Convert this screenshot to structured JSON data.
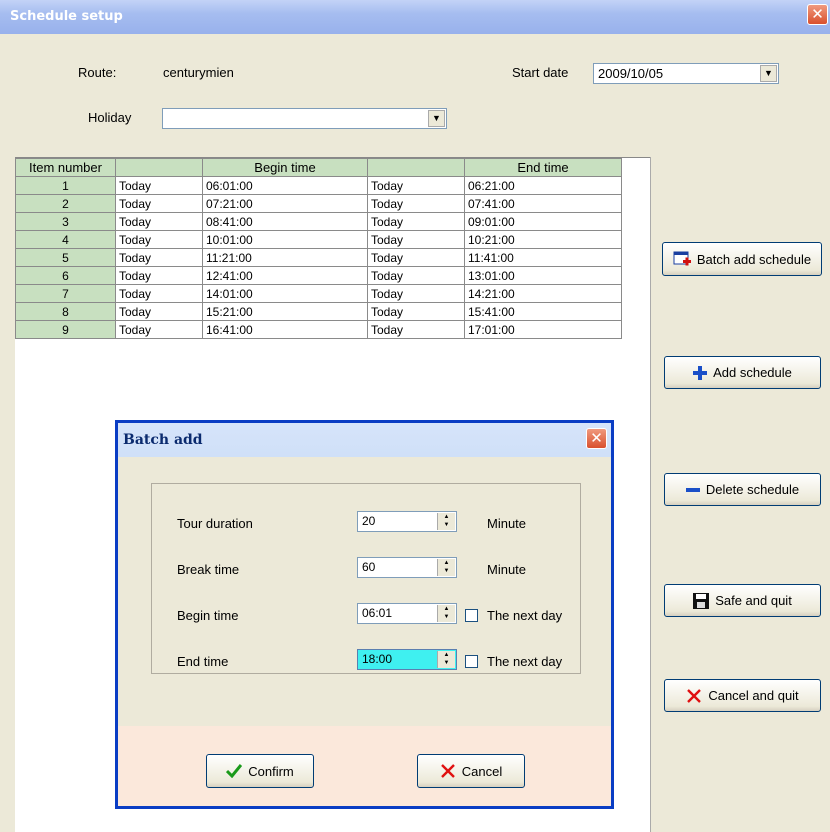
{
  "window": {
    "title": "Schedule setup",
    "close": "✕"
  },
  "form": {
    "route_label": "Route:",
    "route_value": "centurymien",
    "start_date_label": "Start date",
    "start_date_value": "2009/10/05",
    "holiday_label": "Holiday",
    "holiday_value": "",
    "dropdown_arrow": "▼"
  },
  "table": {
    "headers": [
      "Item number",
      "",
      "Begin time",
      "",
      "End time"
    ],
    "rows": [
      [
        "1",
        "Today",
        "06:01:00",
        "Today",
        "06:21:00"
      ],
      [
        "2",
        "Today",
        "07:21:00",
        "Today",
        "07:41:00"
      ],
      [
        "3",
        "Today",
        "08:41:00",
        "Today",
        "09:01:00"
      ],
      [
        "4",
        "Today",
        "10:01:00",
        "Today",
        "10:21:00"
      ],
      [
        "5",
        "Today",
        "11:21:00",
        "Today",
        "11:41:00"
      ],
      [
        "6",
        "Today",
        "12:41:00",
        "Today",
        "13:01:00"
      ],
      [
        "7",
        "Today",
        "14:01:00",
        "Today",
        "14:21:00"
      ],
      [
        "8",
        "Today",
        "15:21:00",
        "Today",
        "15:41:00"
      ],
      [
        "9",
        "Today",
        "16:41:00",
        "Today",
        "17:01:00"
      ]
    ]
  },
  "buttons": {
    "batch_add": "Batch add schedule",
    "add": "Add schedule",
    "delete": "Delete schedule",
    "save_quit": "Safe and quit",
    "cancel_quit": "Cancel and quit"
  },
  "dialog": {
    "title": "Batch add",
    "close": "✕",
    "tour_duration_label": "Tour duration",
    "tour_duration_value": "20",
    "tour_unit": "Minute",
    "break_time_label": "Break time",
    "break_time_value": "60",
    "break_unit": "Minute",
    "begin_time_label": "Begin time",
    "begin_time_value": "06:01",
    "begin_next_day": "The next day",
    "end_time_label": "End time",
    "end_time_value": "18:00",
    "end_next_day": "The next day",
    "confirm": "Confirm",
    "cancel": "Cancel"
  },
  "colors": {
    "accent_blue": "#0a3dc4",
    "header_green": "#c8e0c0",
    "danger_red": "#d9502e"
  }
}
